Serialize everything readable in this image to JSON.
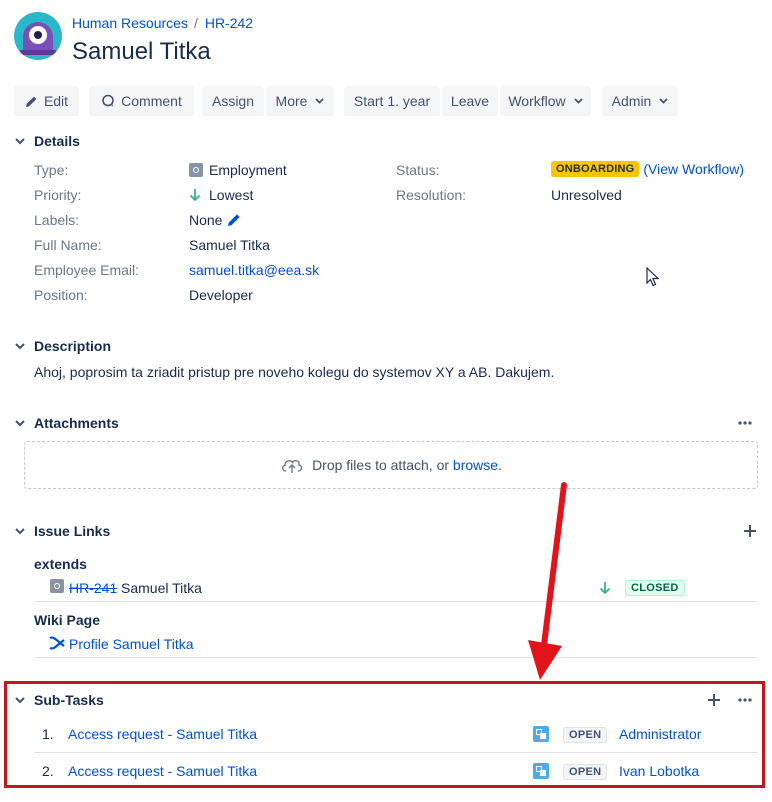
{
  "breadcrumb": {
    "project": "Human Resources",
    "separator": "/",
    "issue_key": "HR-242"
  },
  "issue": {
    "title": "Samuel Titka"
  },
  "toolbar": {
    "edit": "Edit",
    "comment": "Comment",
    "assign": "Assign",
    "more": "More",
    "start": "Start 1. year",
    "leave": "Leave",
    "workflow": "Workflow",
    "admin": "Admin"
  },
  "details": {
    "heading": "Details",
    "type_label": "Type:",
    "type_value": "Employment",
    "priority_label": "Priority:",
    "priority_value": "Lowest",
    "labels_label": "Labels:",
    "labels_value": "None",
    "fullname_label": "Full Name:",
    "fullname_value": "Samuel Titka",
    "email_label": "Employee Email:",
    "email_value": "samuel.titka@eea.sk",
    "position_label": "Position:",
    "position_value": "Developer",
    "status_label": "Status:",
    "status_value": "ONBOARDING",
    "status_link": "(View Workflow)",
    "resolution_label": "Resolution:",
    "resolution_value": "Unresolved"
  },
  "description": {
    "heading": "Description",
    "text": "Ahoj, poprosim ta zriadit pristup pre noveho kolegu do systemov XY a AB. Dakujem."
  },
  "attachments": {
    "heading": "Attachments",
    "drop_text": "Drop files to attach, or",
    "browse": "browse."
  },
  "issue_links": {
    "heading": "Issue Links",
    "groups": [
      {
        "title": "extends",
        "key": "HR-241",
        "summary": "Samuel Titka",
        "status": "CLOSED"
      },
      {
        "title": "Wiki Page",
        "link": "Profile Samuel Titka"
      }
    ]
  },
  "subtasks": {
    "heading": "Sub-Tasks",
    "rows": [
      {
        "num": "1.",
        "title": "Access request - Samuel Titka",
        "status": "OPEN",
        "assignee": "Administrator"
      },
      {
        "num": "2.",
        "title": "Access request - Samuel Titka",
        "status": "OPEN",
        "assignee": "Ivan Lobotka"
      }
    ]
  },
  "colors": {
    "link": "#0052cc",
    "text": "#172b4d",
    "muted": "#6b778c",
    "onboarding": "#ffc400",
    "annotation": "#e2141b"
  }
}
